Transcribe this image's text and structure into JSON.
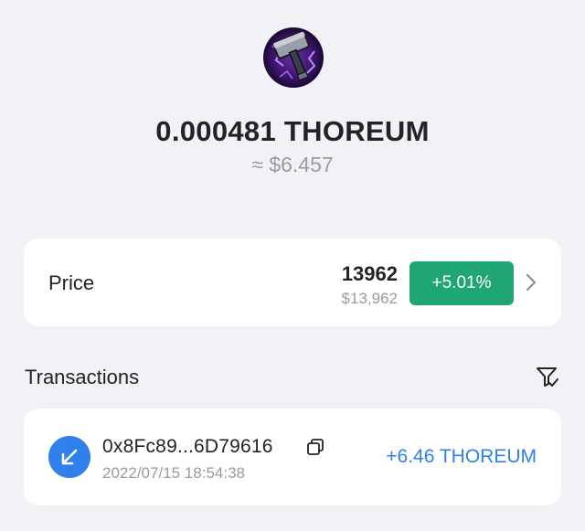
{
  "token": {
    "logo_icon": "hammer-logo-icon",
    "balance": "0.000481 THOREUM",
    "balance_fiat": "≈ $6.457"
  },
  "price_card": {
    "label": "Price",
    "value": "13962",
    "value_fiat": "$13,962",
    "change": "+5.01%",
    "change_color": "#1fa673",
    "chevron_icon": "chevron-right-icon"
  },
  "transactions": {
    "title": "Transactions",
    "filter_icon": "filter-icon",
    "items": [
      {
        "direction_icon": "receive-arrow-icon",
        "address": "0x8Fc89...6D79616",
        "copy_icon": "copy-icon",
        "timestamp": "2022/07/15 18:54:38",
        "amount": "+6.46 THOREUM",
        "amount_color": "#2f80ed"
      }
    ]
  }
}
